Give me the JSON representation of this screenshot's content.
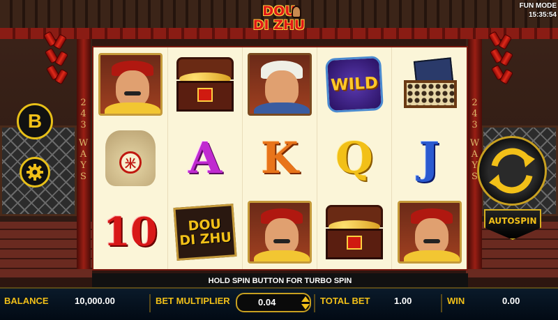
{
  "game": {
    "logo_line1": "DOU",
    "logo_line2": "DI ZHU",
    "mode": "FUN MODE",
    "clock": "15:35:54"
  },
  "side_text": [
    "2",
    "4",
    "3",
    "W",
    "A",
    "Y",
    "S"
  ],
  "reels": {
    "symbols": [
      [
        "official",
        "treasure-chest",
        "servant",
        "wild",
        "abacus-book"
      ],
      [
        "rice-bag",
        "A",
        "K",
        "Q",
        "J"
      ],
      [
        "10",
        "dou-di-zhu-logo",
        "official",
        "treasure-chest",
        "official"
      ]
    ],
    "wild_label": "WILD",
    "logo_tile_line1": "DOU",
    "logo_tile_line2": "DI ZHU",
    "rice_char": "米"
  },
  "buttons": {
    "b_label": "B",
    "autospin_label": "AUTOSPIN"
  },
  "hint": "HOLD SPIN BUTTON FOR TURBO SPIN",
  "footer": {
    "balance_label": "BALANCE",
    "balance_value": "10,000.00",
    "multiplier_label": "BET MULTIPLIER",
    "multiplier_value": "0.04",
    "total_bet_label": "TOTAL BET",
    "total_bet_value": "1.00",
    "win_label": "WIN",
    "win_value": "0.00"
  },
  "colors": {
    "accent_gold": "#f2c018",
    "reel_background": "#fbf5d8",
    "frame_red": "#7a1a10"
  }
}
